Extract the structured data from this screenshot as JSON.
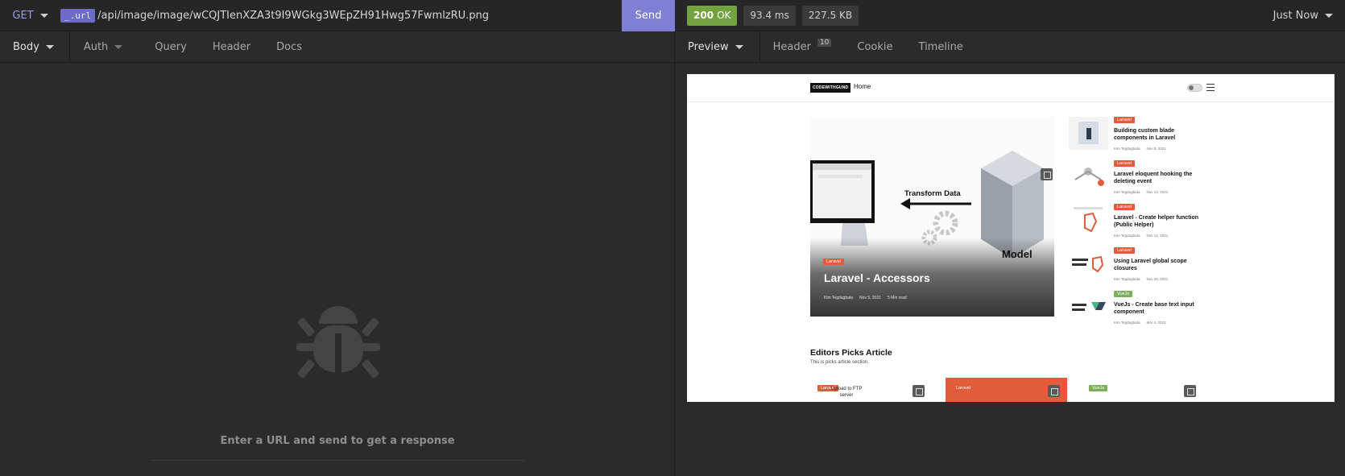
{
  "request": {
    "method": "GET",
    "url_tag": "_.url",
    "url_path": "/api/image/image/wCQJTIenXZA3t9I9WGkg3WEpZH91Hwg57FwmlzRU.png",
    "send_label": "Send",
    "tabs": [
      {
        "label": "Body",
        "has_dropdown": true,
        "active": true
      },
      {
        "label": "Auth",
        "has_dropdown": true,
        "active": false
      },
      {
        "label": "Query",
        "active": false
      },
      {
        "label": "Header",
        "active": false
      },
      {
        "label": "Docs",
        "active": false
      }
    ],
    "empty_state": {
      "icon": "bug-icon",
      "message": "Enter a URL and send to get a response"
    }
  },
  "response": {
    "status_code": "200",
    "status_text": "OK",
    "time": "93.4 ms",
    "size": "227.5 KB",
    "history_label": "Just Now",
    "tabs": [
      {
        "label": "Preview",
        "has_dropdown": true,
        "active": true
      },
      {
        "label": "Header",
        "count": "10"
      },
      {
        "label": "Cookie"
      },
      {
        "label": "Timeline"
      }
    ]
  },
  "preview": {
    "logo": "CODEWITHGUND",
    "nav_home": "Home",
    "hero": {
      "badge": "Laravel",
      "title": "Laravel - Accessors",
      "image_text_1": "Transform Data",
      "image_text_2": "Model",
      "author": "Kim Tegdugbata",
      "date": "Nov 5, 2021",
      "read": "5 Min read"
    },
    "side_articles": [
      {
        "badge": "Laravel",
        "badge_type": "laravel",
        "title": "Building custom blade components in Laravel",
        "author": "Kim Tegdugbata",
        "date": "Nov 8, 2021"
      },
      {
        "badge": "Laravel",
        "badge_type": "laravel",
        "title": "Laravel eloquent hooking the deleting event",
        "author": "Kim Tegdugbata",
        "date": "Nov 13, 2021"
      },
      {
        "badge": "Laravel",
        "badge_type": "laravel",
        "title": "Laravel - Create helper function (Public Helper)",
        "author": "Kim Tegdugbata",
        "date": "Nov 14, 2021"
      },
      {
        "badge": "Laravel",
        "badge_type": "laravel",
        "title": "Using Laravel global scope closures",
        "author": "Kim Tegdugbata",
        "date": "Nov 26, 2021"
      },
      {
        "badge": "VueJs",
        "badge_type": "vue",
        "title": "VueJs - Create base text input component",
        "author": "Kim Tegdugbata",
        "date": "Mar 4, 2022"
      }
    ],
    "editors": {
      "title": "Editors Picks Article",
      "subtitle": "This is picks article section.",
      "cards": [
        {
          "badge": "Laravel",
          "text": "Upload to FTP server"
        },
        {
          "badge": "Laravel",
          "text": ""
        },
        {
          "badge": "VueJs",
          "text": ""
        }
      ]
    },
    "colors": {
      "laravel": "#e25c3c",
      "vue": "#7bb05a"
    }
  },
  "colors": {
    "accent": "#7f7fd6",
    "status_ok": "#73a23f",
    "method": "#9b9be8"
  }
}
